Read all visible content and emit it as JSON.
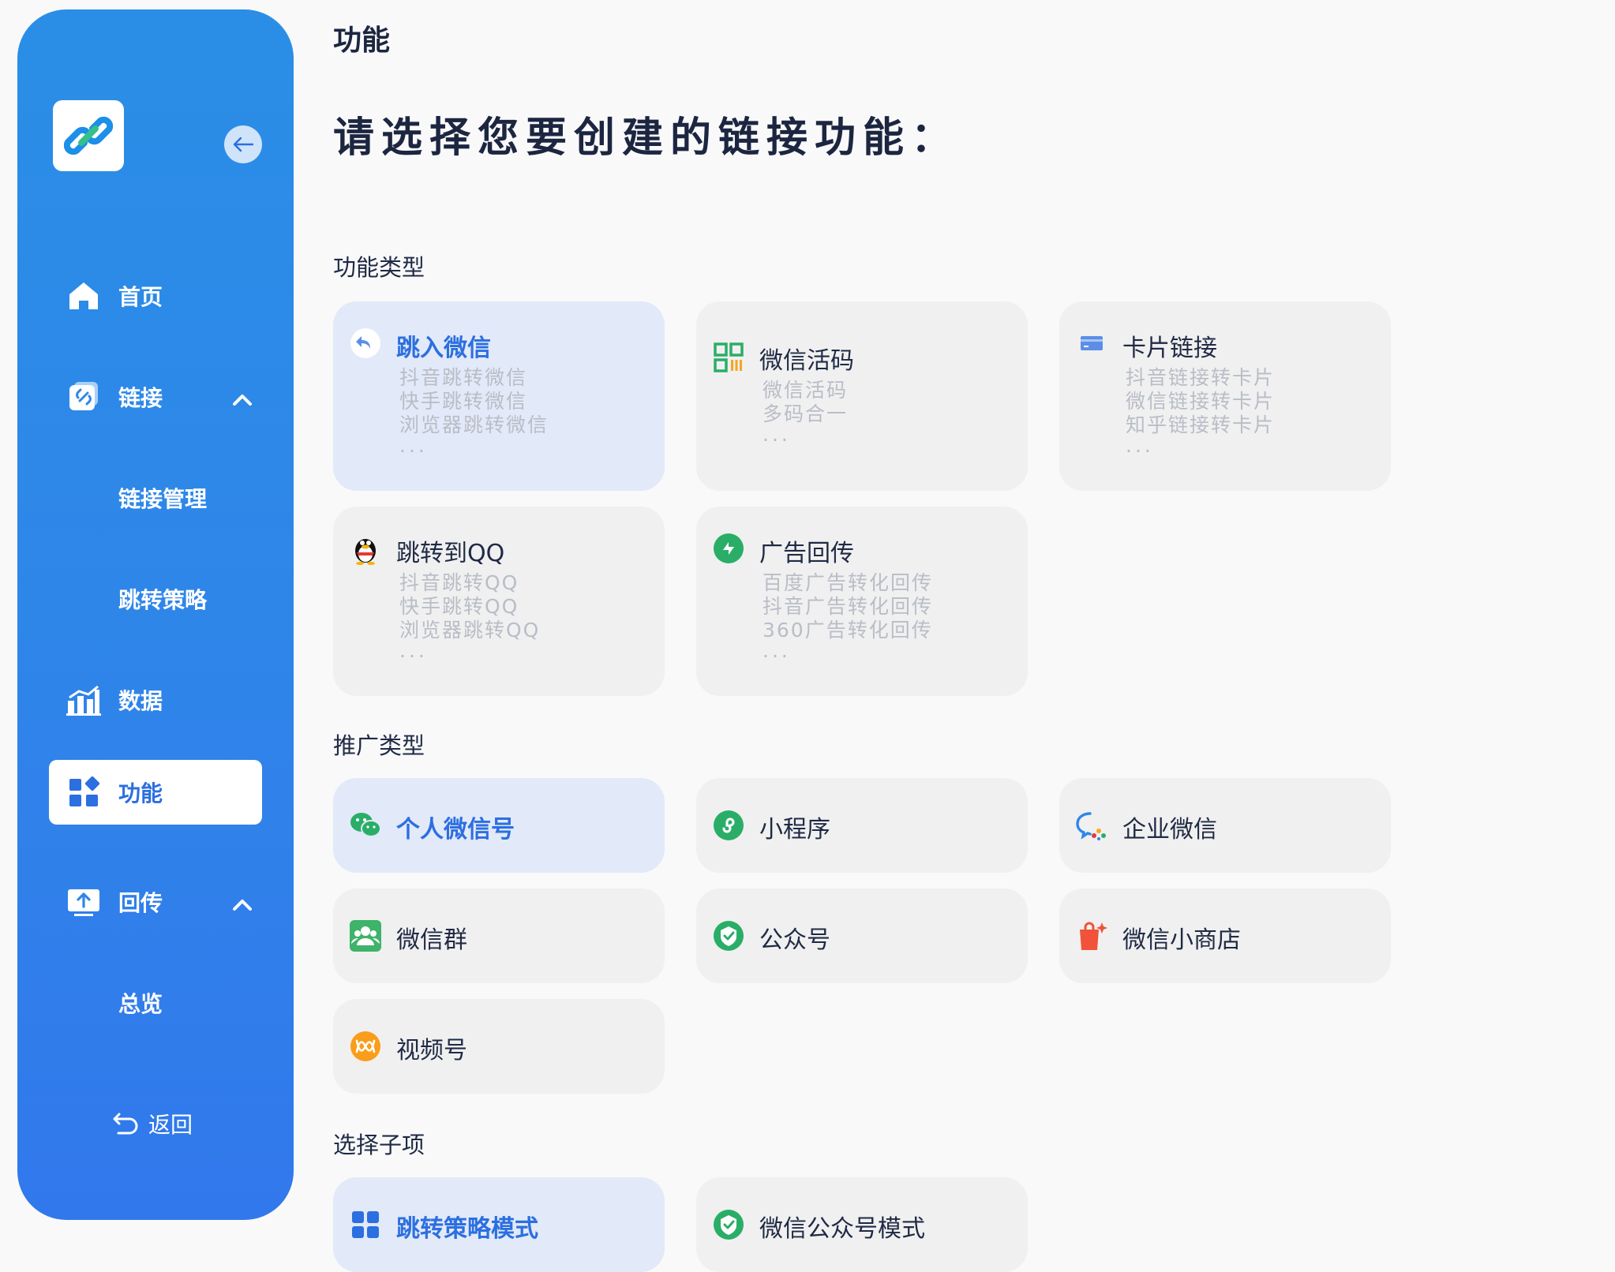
{
  "sidebar": {
    "collapse_icon": "arrow-left-icon",
    "nav": [
      {
        "label": "首页",
        "icon": "home-icon"
      },
      {
        "label": "链接",
        "icon": "link-icon"
      },
      {
        "label": "链接管理"
      },
      {
        "label": "跳转策略"
      },
      {
        "label": "数据",
        "icon": "bar-chart-icon"
      },
      {
        "label": "功能",
        "icon": "widgets-icon",
        "active": true
      },
      {
        "label": "回传",
        "icon": "upload-icon"
      },
      {
        "label": "总览"
      }
    ],
    "back_label": "返回"
  },
  "page": {
    "title": "功能",
    "headline": "请选择您要创建的链接功能："
  },
  "sections": {
    "function_type": {
      "label": "功能类型",
      "cards": [
        {
          "title": "跳入微信",
          "subs": [
            "抖音跳转微信",
            "快手跳转微信",
            "浏览器跳转微信"
          ],
          "more": "...",
          "selected": true
        },
        {
          "title": "微信活码",
          "subs": [
            "微信活码",
            "多码合一"
          ],
          "more": "..."
        },
        {
          "title": "卡片链接",
          "subs": [
            "抖音链接转卡片",
            "微信链接转卡片",
            "知乎链接转卡片"
          ],
          "more": "..."
        },
        {
          "title": "跳转到QQ",
          "subs": [
            "抖音跳转QQ",
            "快手跳转QQ",
            "浏览器跳转QQ"
          ],
          "more": "..."
        },
        {
          "title": "广告回传",
          "subs": [
            "百度广告转化回传",
            "抖音广告转化回传",
            "360广告转化回传"
          ],
          "more": "..."
        }
      ]
    },
    "promo_type": {
      "label": "推广类型",
      "cards": [
        {
          "title": "个人微信号",
          "selected": true
        },
        {
          "title": "小程序"
        },
        {
          "title": "企业微信"
        },
        {
          "title": "微信群"
        },
        {
          "title": "公众号"
        },
        {
          "title": "微信小商店"
        },
        {
          "title": "视频号"
        }
      ]
    },
    "sub_item": {
      "label": "选择子项",
      "cards": [
        {
          "title": "跳转策略模式",
          "selected": true
        },
        {
          "title": "微信公众号模式"
        }
      ]
    }
  },
  "colors": {
    "sidebar_top": "#2a8ee6",
    "sidebar_bottom": "#3178ec",
    "accent": "#2c6fe0",
    "selected_card": "#e2e9f8",
    "card": "#f0f0f0",
    "wechat_green": "#2aae67"
  }
}
